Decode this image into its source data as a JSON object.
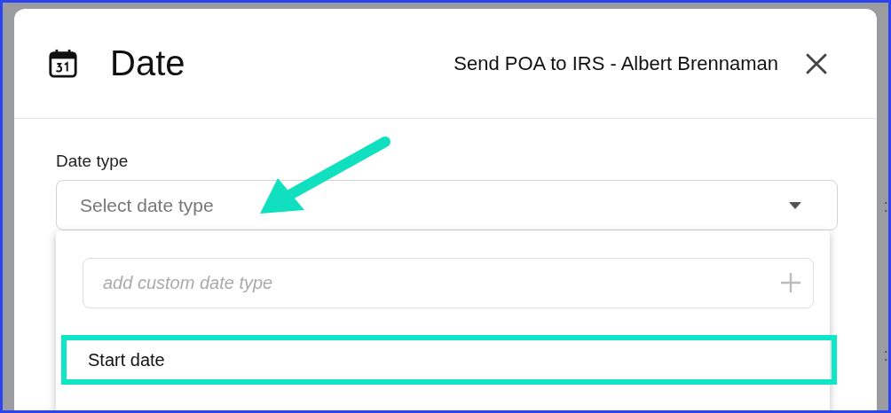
{
  "background": {
    "cells": [
      ":",
      ":"
    ]
  },
  "dialog": {
    "title": "Date",
    "subtitle": "Send POA to IRS - Albert Brennaman"
  },
  "date_type": {
    "label": "Date type",
    "placeholder": "Select date type",
    "expanded": true
  },
  "dropdown": {
    "custom_field": {
      "placeholder": "add custom date type"
    },
    "options": [
      {
        "label": "Start date",
        "highlighted": true
      }
    ]
  },
  "annotation": {
    "kind": "arrow"
  }
}
